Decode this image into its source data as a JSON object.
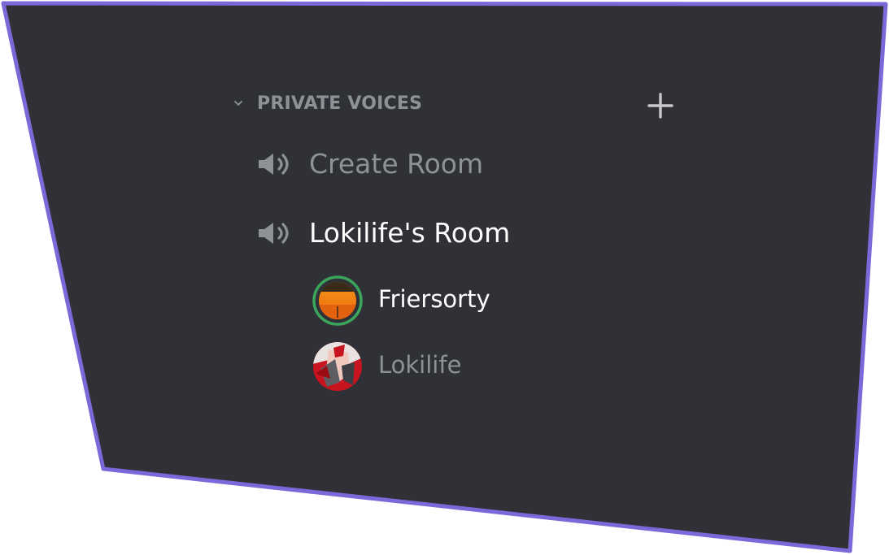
{
  "category": {
    "label": "PRIVATE VOICES",
    "chevron_icon": "chevron-down-icon",
    "add_icon": "plus-icon"
  },
  "channels": [
    {
      "label": "Create Room",
      "icon": "speaker-icon",
      "state": "muted"
    },
    {
      "label": "Lokilife's Room",
      "icon": "speaker-icon",
      "state": "active"
    }
  ],
  "members": [
    {
      "name": "Friersorty",
      "avatar_icon": "sunset-avatar",
      "speaking": true
    },
    {
      "name": "Lokilife",
      "avatar_icon": "character-avatar",
      "speaking": false
    }
  ],
  "colors": {
    "background": "#2f3136",
    "frame": "#7b68d9",
    "muted_text": "#8e9297",
    "active_text": "#ffffff",
    "speaking_ring": "#3ba55c"
  }
}
